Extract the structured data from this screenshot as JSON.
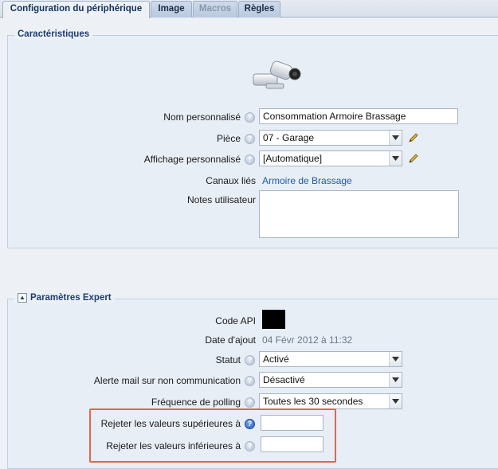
{
  "tabs": [
    {
      "label": "Configuration du périphérique",
      "state": "active"
    },
    {
      "label": "Image",
      "state": "normal"
    },
    {
      "label": "Macros",
      "state": "disabled"
    },
    {
      "label": "Règles",
      "state": "normal"
    }
  ],
  "characteristics": {
    "legend": "Caractéristiques",
    "device_icon": "camera-sensor-icon",
    "name_label": "Nom personnalisé",
    "name_value": "Consommation Armoire Brassage",
    "room_label": "Pièce",
    "room_value": "07 - Garage",
    "display_label": "Affichage personnalisé",
    "display_value": "[Automatique]",
    "channels_label": "Canaux liés",
    "channels_value": "Armoire de Brassage",
    "notes_label": "Notes utilisateur",
    "notes_value": ""
  },
  "expert": {
    "legend": "Paramètres Expert",
    "api_label": "Code API",
    "date_label": "Date d'ajout",
    "date_value": "04 Févr 2012 à 11:32",
    "status_label": "Statut",
    "status_value": "Activé",
    "mail_alert_label": "Alerte mail sur non communication",
    "mail_alert_value": "Désactivé",
    "polling_label": "Fréquence de polling",
    "polling_value": "Toutes les 30 secondes",
    "reject_upper_label": "Rejeter les valeurs supérieures à",
    "reject_upper_value": "",
    "reject_lower_label": "Rejeter les valeurs inférieures à",
    "reject_lower_value": ""
  },
  "colors": {
    "highlight": "#e0664e",
    "link": "#1f5aa8",
    "legend": "#1d3c73"
  }
}
